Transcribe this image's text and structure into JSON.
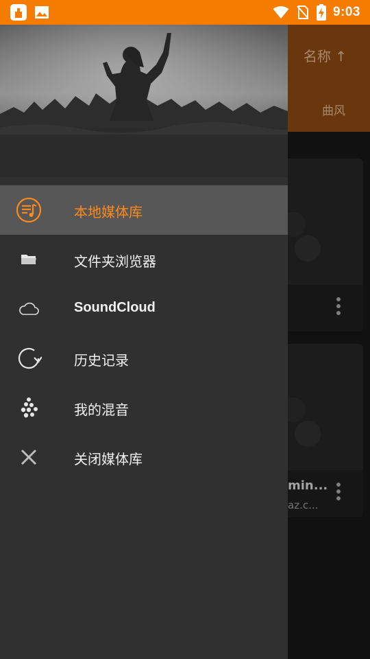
{
  "status_bar": {
    "time": "9:03",
    "left_icons": [
      "notification-app-icon",
      "image-notification-icon"
    ],
    "right_icons": [
      "wifi-icon",
      "no-sim-icon",
      "battery-charging-icon"
    ]
  },
  "background_app": {
    "sort_label": "名称 ↑",
    "tab_label": "曲风",
    "albums": [
      {
        "title": "",
        "subtitle": ""
      },
      {
        "title": "min...",
        "subtitle": "az.c..."
      }
    ]
  },
  "drawer": {
    "nav_items": [
      {
        "label": "本地媒体库",
        "icon": "music-library-icon",
        "active": true
      },
      {
        "label": "文件夹浏览器",
        "icon": "folder-icon",
        "active": false
      },
      {
        "label": "SoundCloud",
        "icon": "cloud-icon",
        "active": false
      },
      {
        "label": "历史记录",
        "icon": "history-icon",
        "active": false
      },
      {
        "label": "我的混音",
        "icon": "mix-icon",
        "active": false
      },
      {
        "label": "关闭媒体库",
        "icon": "close-icon",
        "active": false
      }
    ]
  },
  "colors": {
    "accent": "#ff8a1c",
    "status_bar": "#f57c00",
    "toolbar_dimmed": "#8c4a12",
    "drawer_bg": "#303030",
    "active_item_bg": "#575757"
  }
}
